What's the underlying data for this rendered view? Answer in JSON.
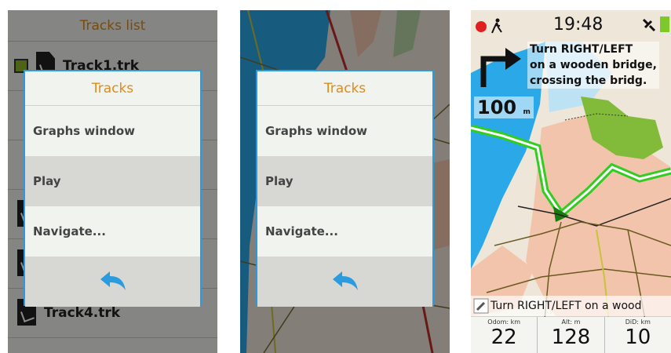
{
  "tracks_list": {
    "header": "Tracks list",
    "items": [
      "Track1.trk",
      "Track4.trk"
    ]
  },
  "dialog": {
    "title": "Tracks",
    "items": [
      "Graphs window",
      "Play",
      "Navigate..."
    ],
    "selected_index": 1,
    "back_icon": "back-arrow-icon"
  },
  "navigation": {
    "time": "19:48",
    "instruction": [
      "Turn RIGHT/LEFT",
      "on a wooden bridge,",
      "crossing the bridg."
    ],
    "distance_value": "100",
    "distance_unit": "m",
    "banner": "Turn RIGHT/LEFT on a wood",
    "stats": [
      {
        "label": "Odom: km",
        "value": "22"
      },
      {
        "label": "Alt: m",
        "value": "128"
      },
      {
        "label": "DiD: km",
        "value": "10"
      }
    ]
  },
  "colors": {
    "accent": "#2b9be0",
    "title": "#e08b17",
    "route": "#44dd22",
    "record": "#e02020"
  }
}
